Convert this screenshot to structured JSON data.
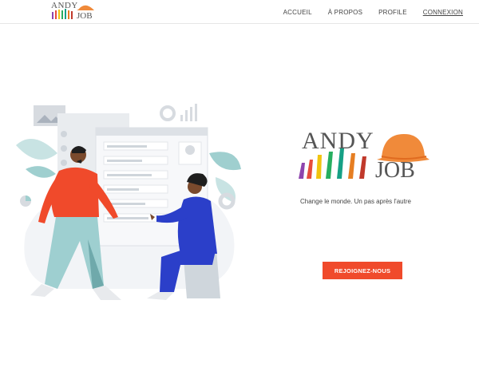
{
  "brand": {
    "logo_line1": "ANDY",
    "logo_line2": "JOB"
  },
  "nav": {
    "items": [
      {
        "label": "ACCUEIL"
      },
      {
        "label": "À PROPOS"
      },
      {
        "label": "PROFILE"
      },
      {
        "label": "CONNEXION"
      }
    ]
  },
  "hero": {
    "tagline": "Change le monde. Un pas après l'autre",
    "cta_label": "REJOIGNEZ-NOUS"
  },
  "colors": {
    "accent": "#f04a2b",
    "hat_orange": "#f08a3a"
  },
  "icons": [
    "hands-logo-icon",
    "hard-hat-icon"
  ]
}
